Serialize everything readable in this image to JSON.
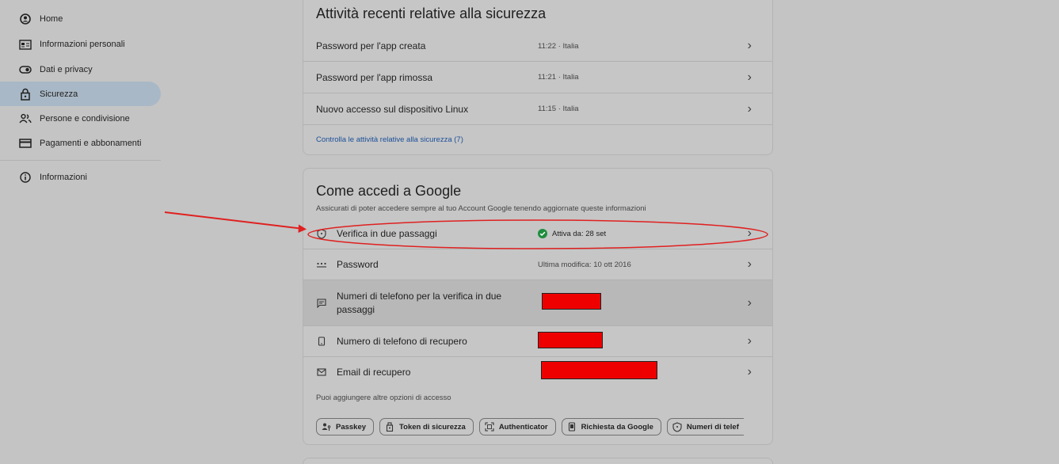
{
  "sidebar": {
    "items": [
      {
        "label": "Home",
        "icon": "account-circle-icon"
      },
      {
        "label": "Informazioni personali",
        "icon": "id-card-icon"
      },
      {
        "label": "Dati e privacy",
        "icon": "toggle-icon"
      },
      {
        "label": "Sicurezza",
        "icon": "lock-icon",
        "active": true
      },
      {
        "label": "Persone e condivisione",
        "icon": "people-icon"
      },
      {
        "label": "Pagamenti e abbonamenti",
        "icon": "credit-card-icon"
      },
      {
        "label": "Informazioni",
        "icon": "info-icon"
      }
    ]
  },
  "recent_activity": {
    "title": "Attività recenti relative alla sicurezza",
    "rows": [
      {
        "label": "Password per l'app creata",
        "value": "11:22 · Italia"
      },
      {
        "label": "Password per l'app rimossa",
        "value": "11:21 · Italia"
      },
      {
        "label": "Nuovo accesso sul dispositivo Linux",
        "value": "11:15 · Italia"
      }
    ],
    "link": "Controlla le attività relative alla sicurezza (7)"
  },
  "signin": {
    "title": "Come accedi a Google",
    "subtitle": "Assicurati di poter accedere sempre al tuo Account Google tenendo aggiornate queste informazioni",
    "rows": [
      {
        "label": "Verifica in due passaggi",
        "value": "Attiva da: 28 set",
        "icon": "shield-icon"
      },
      {
        "label": "Password",
        "value": "Ultima modifica: 10 ott 2016",
        "icon": "password-dots-icon"
      },
      {
        "label": "Numeri di telefono per la verifica in due passaggi",
        "value": "",
        "icon": "message-icon"
      },
      {
        "label": "Numero di telefono di recupero",
        "value": "",
        "icon": "phone-icon"
      },
      {
        "label": "Email di recupero",
        "value": "",
        "icon": "mail-icon"
      }
    ],
    "more_options_label": "Puoi aggiungere altre opzioni di accesso",
    "chips": [
      {
        "label": "Passkey",
        "icon": "passkey-icon"
      },
      {
        "label": "Token di sicurezza",
        "icon": "security-key-icon"
      },
      {
        "label": "Authenticator",
        "icon": "qr-code-icon"
      },
      {
        "label": "Richiesta da Google",
        "icon": "phone-prompt-icon"
      },
      {
        "label": "Numeri di telef",
        "icon": "shield-icon"
      }
    ]
  },
  "colors": {
    "background": "#c4c4c4",
    "sidebar_active": "#a9b8c6",
    "link": "#1a4f99",
    "status_ok": "#1e8e3e",
    "annotation": "#e02020",
    "redaction": "#ee0000"
  }
}
